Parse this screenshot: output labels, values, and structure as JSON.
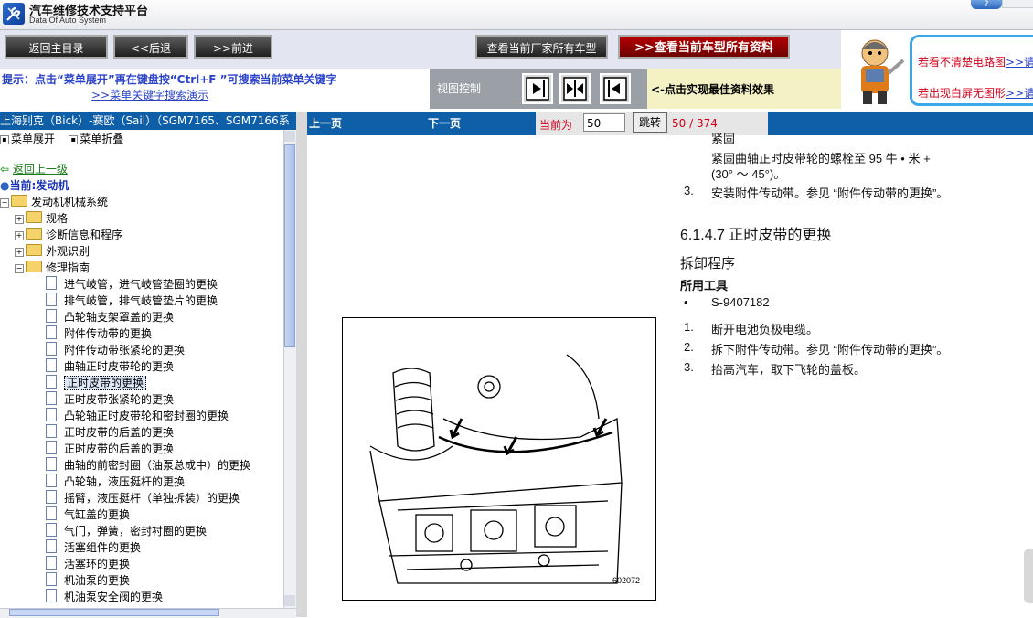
{
  "app": {
    "title": "汽车维修技术支持平台",
    "subtitle": "Data Of Auto System"
  },
  "toolbar": {
    "home_label": "返回主目录",
    "back_label": "<<后退",
    "forward_label": ">>前进",
    "models_label": "查看当前厂家所有车型",
    "all_data_label": "查看当前车型所有资料"
  },
  "hint": {
    "text": "提示：点击“菜单展开”再在键盘按“Ctrl+F ”可搜索当前菜单关键字",
    "link": ">>菜单关键字搜索演示"
  },
  "view_control": {
    "label": "视图控制",
    "tip": "<-点击实现最佳资料效果"
  },
  "ad": {
    "line1": "若看不清楚电路图",
    "line1_link": ">>请",
    "line2": "若出现白屏无图形",
    "line2_link": ">>请"
  },
  "left_panel": {
    "vehicle": "上海别克（Bick）-赛欧（Sail）（SGM7165、SGM7166系",
    "expand_label": "菜单展开",
    "collapse_label": "菜单折叠",
    "back_label": "返回上一级",
    "current_label": "当前:发动机",
    "root": "发动机机械系统",
    "folders": [
      "规格",
      "诊断信息和程序",
      "外观识别",
      "修理指南"
    ],
    "items": [
      "进气岐管，进气岐管垫圈的更换",
      "排气岐管，排气岐管垫片的更换",
      "凸轮轴支架罩盖的更换",
      "附件传动带的更换",
      "附件传动带张紧轮的更换",
      "曲轴正时皮带轮的更换",
      "正时皮带的更换",
      "正时皮带张紧轮的更换",
      "凸轮轴正时皮带轮和密封圈的更换",
      "正时皮带的后盖的更换",
      "正时皮带的后盖的更换",
      "曲轴的前密封圈（油泵总成中）的更换",
      "凸轮轴，液压挺杆的更换",
      "摇臂，液压挺杆（单独拆装）的更换",
      "气缸盖的更换",
      "气门，弹簧，密封衬圈的更换",
      "活塞组件的更换",
      "活塞环的更换",
      "机油泵的更换",
      "机油泵安全阀的更换"
    ],
    "selected_index": 6
  },
  "doc_nav": {
    "prev": "上一页",
    "next": "下一页",
    "current_label": "当前为",
    "page_value": "50",
    "jump_label": "跳转",
    "page_count": "50 / 374"
  },
  "doc": {
    "top_partial": "紧固",
    "tighten_line1": "紧固曲轴正时皮带轮的螺栓至 95 牛 • 米 +",
    "tighten_line2": "(30° ～ 45°)。",
    "step3_num": "3.",
    "step3_text": "安装附件传动带。参见 “附件传动带的更换”。",
    "section": "6.1.4.7 正时皮带的更换",
    "removal_title": "拆卸程序",
    "tools_title": "所用工具",
    "tool_bullet": "•",
    "tool": "S-9407182",
    "steps": [
      {
        "num": "1.",
        "text": "断开电池负极电缆。"
      },
      {
        "num": "2.",
        "text": "拆下附件传动带。参见 “附件传动带的更换”。"
      },
      {
        "num": "3.",
        "text": "抬高汽车，取下飞轮的盖板。"
      }
    ],
    "figure_id": "602072"
  }
}
